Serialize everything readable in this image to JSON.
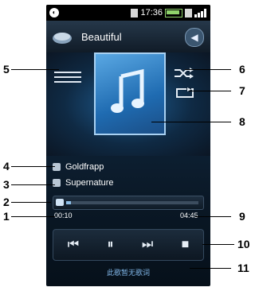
{
  "status_bar": {
    "time": "17:36"
  },
  "header": {
    "title": "Beautiful"
  },
  "track": {
    "artist": "Goldfrapp",
    "album": "Supernature"
  },
  "progress": {
    "elapsed": "00:10",
    "total": "04:45",
    "fraction": 0.035
  },
  "lyrics": {
    "text": "此歌暂无歌词"
  },
  "callouts": {
    "n1": "1",
    "n2": "2",
    "n3": "3",
    "n4": "4",
    "n5": "5",
    "n6": "6",
    "n7": "7",
    "n8": "8",
    "n9": "9",
    "n10": "10",
    "n11": "11"
  },
  "icons": {
    "menu": "menu-icon",
    "shuffle": "shuffle-icon",
    "repeat": "repeat-icon",
    "prev": "previous-icon",
    "pause": "pause-icon",
    "next": "next-icon",
    "stop": "stop-icon"
  }
}
